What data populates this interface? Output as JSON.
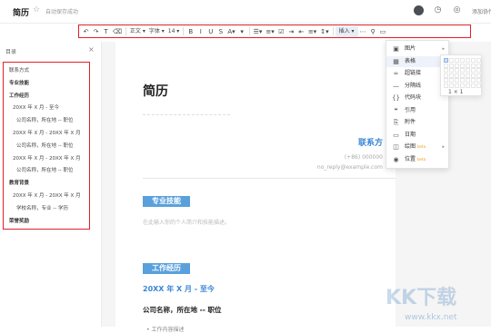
{
  "topbar": {
    "title": "简历",
    "saved": "自动保存成功",
    "star_icon": "star-icon",
    "collab_label": "添加协作"
  },
  "toolbar": {
    "items": [
      {
        "name": "undo-icon",
        "label": "↶"
      },
      {
        "name": "redo-icon",
        "label": "↷"
      },
      {
        "name": "format-painter-icon",
        "label": "T"
      },
      {
        "name": "clear-format-icon",
        "label": "⌫"
      },
      {
        "name": "paragraph-select",
        "label": "正文 ▾"
      },
      {
        "name": "font-select",
        "label": "字体 ▾"
      },
      {
        "name": "font-size-select",
        "label": "14 ▾"
      },
      {
        "name": "bold-icon",
        "label": "B"
      },
      {
        "name": "italic-icon",
        "label": "I"
      },
      {
        "name": "underline-icon",
        "label": "U"
      },
      {
        "name": "strikethrough-icon",
        "label": "S"
      },
      {
        "name": "font-color-icon",
        "label": "A▾"
      },
      {
        "name": "highlight-icon",
        "label": "▾"
      },
      {
        "name": "bulleted-list-icon",
        "label": "☰▾"
      },
      {
        "name": "numbered-list-icon",
        "label": "≡▾"
      },
      {
        "name": "checklist-icon",
        "label": "☑"
      },
      {
        "name": "indent-icon",
        "label": "⇥"
      },
      {
        "name": "outdent-icon",
        "label": "⇤"
      },
      {
        "name": "align-icon",
        "label": "≡▾"
      },
      {
        "name": "line-height-icon",
        "label": "↕▾"
      },
      {
        "name": "insert-button",
        "label": "插入 ▾"
      },
      {
        "name": "more-icon",
        "label": "⋯"
      },
      {
        "name": "search-icon",
        "label": "⚲"
      },
      {
        "name": "comment-icon",
        "label": "▭"
      }
    ]
  },
  "sidebar": {
    "heading": "目录",
    "items": [
      {
        "label": "联系方式",
        "bold": false,
        "indent": 0
      },
      {
        "label": "专业技能",
        "bold": true,
        "indent": 0
      },
      {
        "label": "工作经历",
        "bold": true,
        "indent": 0
      },
      {
        "label": "20XX 年 X 月 - 至今",
        "bold": false,
        "indent": 1
      },
      {
        "label": "公司名称，所在地 -- 职位",
        "bold": false,
        "indent": 2
      },
      {
        "label": "20XX 年 X 月 - 20XX 年 X 月",
        "bold": false,
        "indent": 1
      },
      {
        "label": "公司名称，所在地 -- 职位",
        "bold": false,
        "indent": 2
      },
      {
        "label": "20XX 年 X 月 - 20XX 年 X 月",
        "bold": false,
        "indent": 1
      },
      {
        "label": "公司名称，所在地 -- 职位",
        "bold": false,
        "indent": 2
      },
      {
        "label": "教育背景",
        "bold": true,
        "indent": 0
      },
      {
        "label": "20XX 年 X 月 - 20XX 年 X 月",
        "bold": false,
        "indent": 1
      },
      {
        "label": "学校名称，专业 -- 学历",
        "bold": false,
        "indent": 2
      },
      {
        "label": "荣誉奖励",
        "bold": true,
        "indent": 0
      }
    ]
  },
  "document": {
    "title": "简历",
    "contact_heading": "联系方",
    "phone": "(+86) 000000",
    "email": "no_reply@example.com",
    "section_skills": "专业技能",
    "skills_hint": "在此输入你的个人简介和技能描述。",
    "section_work": "工作经历",
    "work_date": "20XX 年 X 月 - 至今",
    "work_company": "公司名称，所在地 -- 职位",
    "work_bullet": "工作内容描述"
  },
  "insert_menu": {
    "items": [
      {
        "name": "image",
        "icon": "▣",
        "label": "图片",
        "arrow": "▸",
        "badge": ""
      },
      {
        "name": "table",
        "icon": "▦",
        "label": "表格",
        "arrow": "▸",
        "badge": ""
      },
      {
        "name": "link",
        "icon": "∞",
        "label": "超链接",
        "arrow": "",
        "badge": ""
      },
      {
        "name": "divider",
        "icon": "—",
        "label": "分隔线",
        "arrow": "",
        "badge": ""
      },
      {
        "name": "code",
        "icon": "{}",
        "label": "代码块",
        "arrow": "",
        "badge": ""
      },
      {
        "name": "quote",
        "icon": "❝",
        "label": "引用",
        "arrow": "",
        "badge": ""
      },
      {
        "name": "attachment",
        "icon": "⎘",
        "label": "附件",
        "arrow": "",
        "badge": ""
      },
      {
        "name": "date",
        "icon": "▭",
        "label": "日期",
        "arrow": "",
        "badge": ""
      },
      {
        "name": "flowchart",
        "icon": "◫",
        "label": "绘图",
        "arrow": "▸",
        "badge": "beta"
      },
      {
        "name": "location",
        "icon": "◉",
        "label": "位置",
        "arrow": "",
        "badge": "beta"
      }
    ],
    "grid_size": "1 × 1"
  },
  "watermark": {
    "main": "KK下载",
    "sub": "www.kkx.net"
  }
}
